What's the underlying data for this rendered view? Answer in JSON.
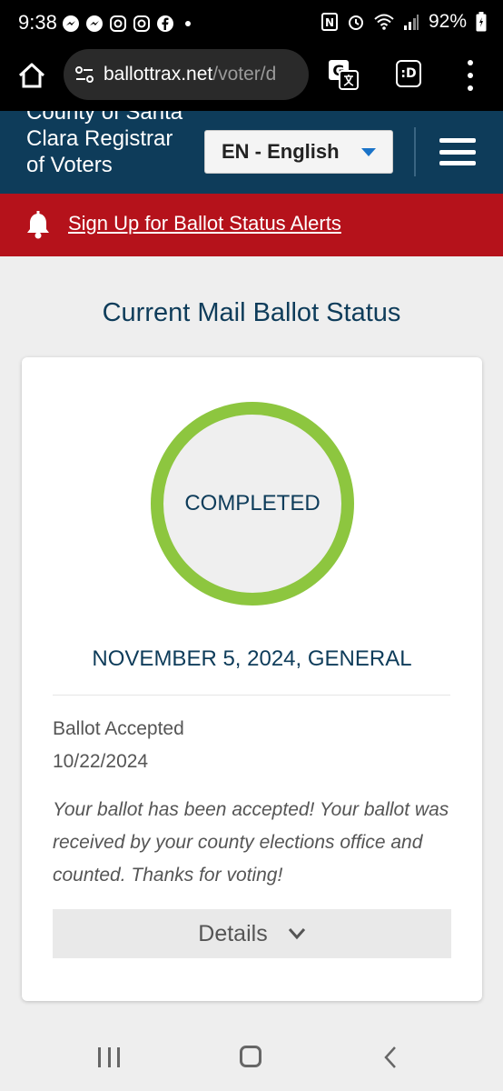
{
  "status_bar": {
    "time": "9:38",
    "battery": "92%",
    "left_icons": [
      "messenger-icon",
      "messenger-icon",
      "instagram-icon",
      "instagram-icon",
      "facebook-icon"
    ],
    "right_icons": [
      "nfc-icon",
      "alarm-icon",
      "wifi-icon",
      "signal-icon",
      "battery-icon"
    ]
  },
  "browser": {
    "url_host": "ballottrax.net",
    "url_path": "/voter/d",
    "tab_label": ":D"
  },
  "header": {
    "county_title": "County of Santa Clara Registrar of Voters",
    "language": "EN - English"
  },
  "alert": {
    "link_text": "Sign Up for Ballot Status Alerts"
  },
  "main": {
    "heading": "Current Mail Ballot Status",
    "status_ring": "COMPLETED",
    "election": "NOVEMBER 5, 2024, GENERAL",
    "ballot_status": "Ballot Accepted",
    "ballot_date": "10/22/2024",
    "ballot_message": "Your ballot has been accepted! Your ballot was received by your county elections office and counted. Thanks for voting!",
    "details_label": "Details"
  },
  "colors": {
    "header_bg": "#0e3c5a",
    "alert_bg": "#b5121b",
    "ring_color": "#8dc63f",
    "accent_caret": "#1a73c8"
  }
}
